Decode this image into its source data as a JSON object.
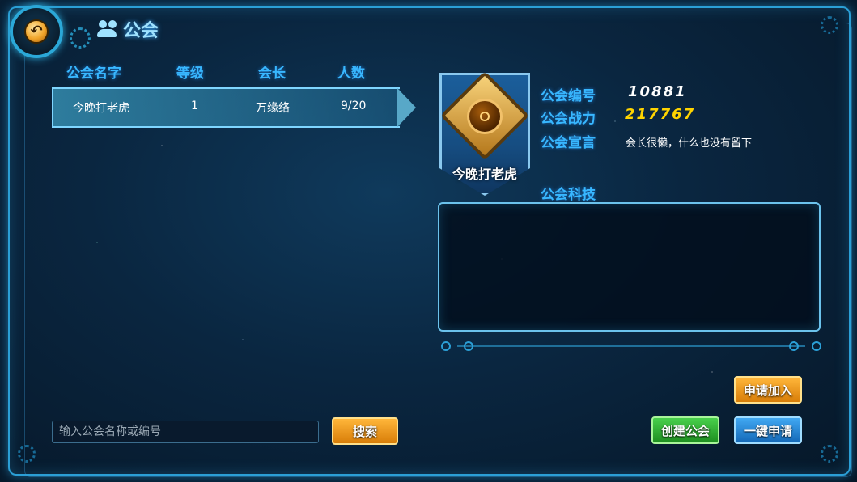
{
  "header": {
    "title": "公会"
  },
  "list": {
    "columns": [
      "公会名字",
      "等级",
      "会长",
      "人数"
    ],
    "rows": [
      {
        "name": "今晚打老虎",
        "level": "1",
        "leader": "万缘络",
        "members": "9/20"
      }
    ]
  },
  "detail": {
    "emblem_name": "今晚打老虎",
    "id_label": "公会编号",
    "id_value": "10881",
    "power_label": "公会战力",
    "power_value": "217767",
    "declaration_label": "公会宣言",
    "declaration_value": "会长很懒，什么也没有留下",
    "tech_label": "公会科技"
  },
  "actions": {
    "apply_join": "申请加入",
    "create": "创建公会",
    "quick_apply": "一键申请",
    "search": "搜索"
  },
  "search": {
    "placeholder": "输入公会名称或编号"
  },
  "colors": {
    "accent": "#38b7ff",
    "power": "#ffd400",
    "frame": "#2b9fd6"
  }
}
